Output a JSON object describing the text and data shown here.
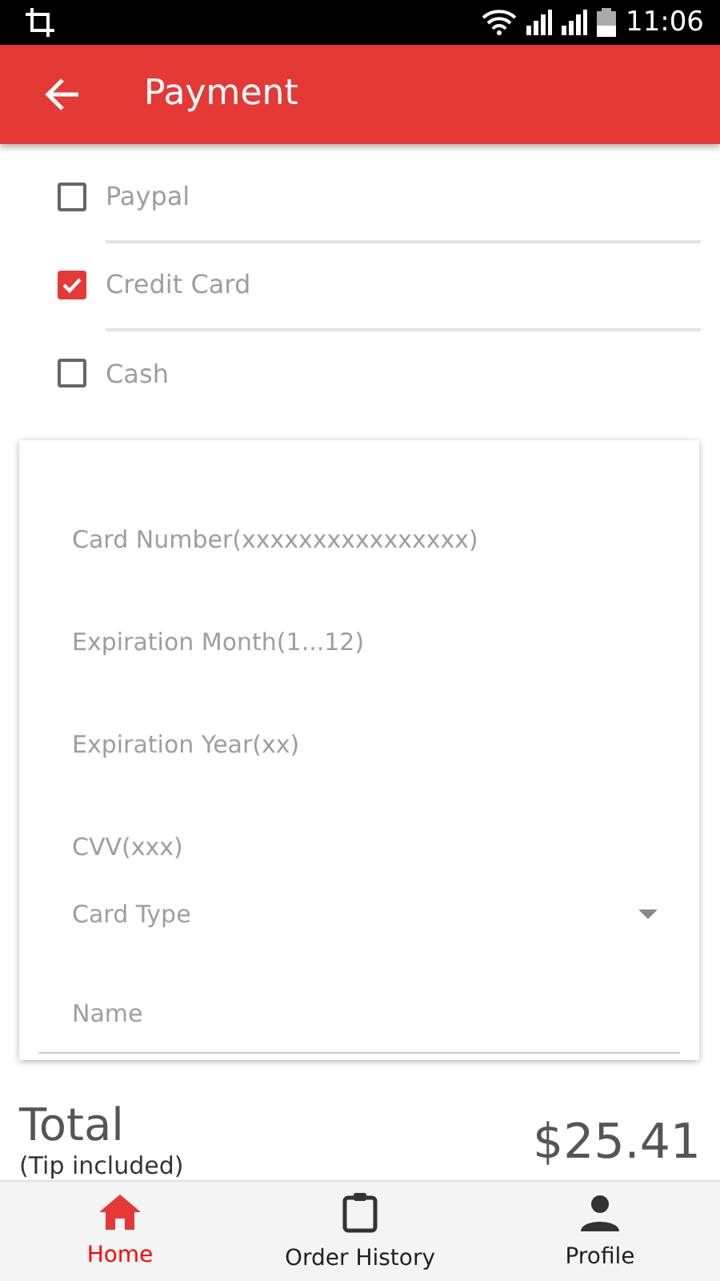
{
  "status_bar": {
    "time": "11:06"
  },
  "app_bar": {
    "title": "Payment"
  },
  "payment_methods": [
    {
      "label": "Paypal",
      "checked": false
    },
    {
      "label": "Credit Card",
      "checked": true
    },
    {
      "label": "Cash",
      "checked": false
    }
  ],
  "card_form": {
    "fields": [
      {
        "kind": "text",
        "placeholder": "Card Number(xxxxxxxxxxxxxxxx)"
      },
      {
        "kind": "text",
        "placeholder": "Expiration Month(1...12)"
      },
      {
        "kind": "text",
        "placeholder": "Expiration Year(xx)"
      },
      {
        "kind": "text",
        "placeholder": "CVV(xxx)"
      },
      {
        "kind": "select",
        "placeholder": "Card Type"
      },
      {
        "kind": "underlined",
        "placeholder": "Name"
      }
    ]
  },
  "total": {
    "label": "Total",
    "note": "(Tip included)",
    "amount": "$25.41"
  },
  "bottom_nav": [
    {
      "label": "Home",
      "kind": "home",
      "selected": true
    },
    {
      "label": "Order History",
      "kind": "clipboard",
      "selected": false
    },
    {
      "label": "Profile",
      "kind": "person",
      "selected": false
    }
  ]
}
